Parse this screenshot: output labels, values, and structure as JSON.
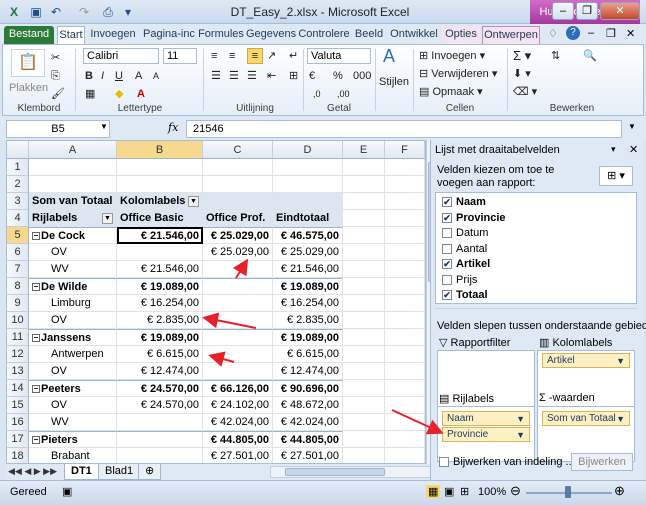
{
  "window": {
    "title": "DT_Easy_2.xlsx - Microsoft Excel",
    "context_tab": "Hulpmiddelen vo..."
  },
  "tabs": [
    "Bestand",
    "Start",
    "Invoegen",
    "Pagina-inc",
    "Formules",
    "Gegevens",
    "Controlere",
    "Beeld",
    "Ontwikkel",
    "Opties",
    "Ontwerpen"
  ],
  "ribbon": {
    "plakken": "Plakken",
    "font_name": "Calibri",
    "font_size": "11",
    "number_format": "Valuta",
    "stijlen": "Stijlen",
    "invoegen": "Invoegen",
    "verwijderen": "Verwijderen",
    "opmaak": "Opmaak",
    "groups": [
      "Klembord",
      "Lettertype",
      "Uitlijning",
      "Getal",
      "Cellen",
      "Bewerken"
    ]
  },
  "formula_bar": {
    "name_box": "B5",
    "fx": "fx",
    "formula": "21546"
  },
  "columns": [
    "A",
    "B",
    "C",
    "D",
    "E",
    "F"
  ],
  "rows": [
    {
      "n": "1",
      "a": "",
      "b": "",
      "c": "",
      "d": ""
    },
    {
      "n": "2",
      "a": "",
      "b": "",
      "c": "",
      "d": ""
    },
    {
      "n": "3",
      "a": "Som van Totaal",
      "b": "Kolomlabels",
      "c": "",
      "d": ""
    },
    {
      "n": "4",
      "a": "Rijlabels",
      "b": "Office Basic",
      "c": "Office Prof.",
      "d": "Eindtotaal"
    },
    {
      "n": "5",
      "a": "De Cock",
      "b": "€ 21.546,00",
      "c": "€ 25.029,00",
      "d": "€ 46.575,00"
    },
    {
      "n": "6",
      "a": "OV",
      "b": "",
      "c": "€ 25.029,00",
      "d": "€ 25.029,00"
    },
    {
      "n": "7",
      "a": "WV",
      "b": "€ 21.546,00",
      "c": "",
      "d": "€ 21.546,00"
    },
    {
      "n": "8",
      "a": "De Wilde",
      "b": "€ 19.089,00",
      "c": "",
      "d": "€ 19.089,00"
    },
    {
      "n": "9",
      "a": "Limburg",
      "b": "€ 16.254,00",
      "c": "",
      "d": "€ 16.254,00"
    },
    {
      "n": "10",
      "a": "OV",
      "b": "€ 2.835,00",
      "c": "",
      "d": "€ 2.835,00"
    },
    {
      "n": "11",
      "a": "Janssens",
      "b": "€ 19.089,00",
      "c": "",
      "d": "€ 19.089,00"
    },
    {
      "n": "12",
      "a": "Antwerpen",
      "b": "€ 6.615,00",
      "c": "",
      "d": "€ 6.615,00"
    },
    {
      "n": "13",
      "a": "OV",
      "b": "€ 12.474,00",
      "c": "",
      "d": "€ 12.474,00"
    },
    {
      "n": "14",
      "a": "Peeters",
      "b": "€ 24.570,00",
      "c": "€ 66.126,00",
      "d": "€ 90.696,00"
    },
    {
      "n": "15",
      "a": "OV",
      "b": "€ 24.570,00",
      "c": "€ 24.102,00",
      "d": "€ 48.672,00"
    },
    {
      "n": "16",
      "a": "WV",
      "b": "",
      "c": "€ 42.024,00",
      "d": "€ 42.024,00"
    },
    {
      "n": "17",
      "a": "Pieters",
      "b": "",
      "c": "€ 44.805,00",
      "d": "€ 44.805,00"
    },
    {
      "n": "18",
      "a": "Brabant",
      "b": "",
      "c": "€ 27.501,00",
      "d": "€ 27.501,00"
    }
  ],
  "sheet_tabs": [
    "DT1",
    "Blad1"
  ],
  "status": {
    "ready": "Gereed",
    "zoom": "100%"
  },
  "panel": {
    "title": "Lijst met draaitabelvelden",
    "instruction": "Velden kiezen om toe te voegen aan rapport:",
    "fields": [
      {
        "label": "Naam",
        "checked": true
      },
      {
        "label": "Provincie",
        "checked": true
      },
      {
        "label": "Datum",
        "checked": false
      },
      {
        "label": "Aantal",
        "checked": false
      },
      {
        "label": "Artikel",
        "checked": true
      },
      {
        "label": "Prijs",
        "checked": false
      },
      {
        "label": "Totaal",
        "checked": true
      }
    ],
    "drag_text": "Velden slepen tussen onderstaande gebieden:",
    "rapportfilter": "Rapportfilter",
    "kolomlabels": "Kolomlabels",
    "rijlabels": "Rijlabels",
    "waarden": "-waarden",
    "col_items": [
      "Artikel"
    ],
    "row_items": [
      "Naam",
      "Provincie"
    ],
    "value_items": [
      "Som van Totaal"
    ],
    "defer_label": "Bijwerken van indeling ...",
    "update_button": "Bijwerken"
  }
}
